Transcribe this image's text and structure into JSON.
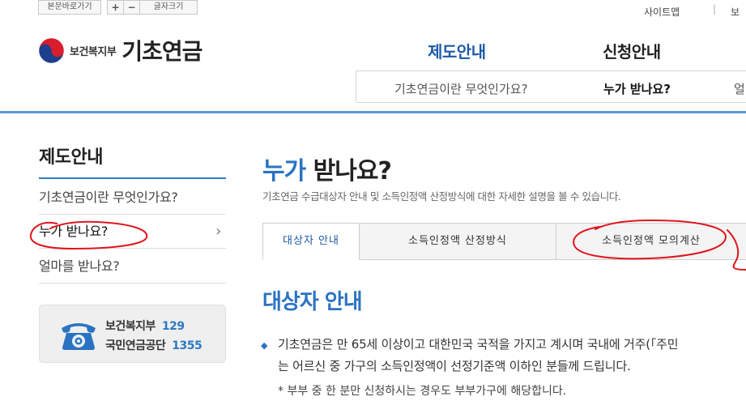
{
  "utility": {
    "skip_label": "본문바로가기",
    "font_plus": "+",
    "font_minus": "−",
    "font_size_label": "글자크기",
    "sitemap": "사이트맵",
    "separator": "|",
    "partial_right": "보"
  },
  "logo": {
    "ministry": "보건복지부",
    "name": "기초연금"
  },
  "gnb": {
    "items": [
      {
        "label": "제도안내"
      },
      {
        "label": "신청안내"
      }
    ],
    "subnav": [
      "기초연금이란 무엇인가요?",
      "누가 받나요?",
      "얼"
    ]
  },
  "lnb": {
    "title": "제도안내",
    "items": [
      {
        "label": "기초연금이란 무엇인가요?"
      },
      {
        "label": "누가 받나요?",
        "chevron": "›"
      },
      {
        "label": "얼마를 받나요?"
      }
    ]
  },
  "contact": {
    "org1": "보건복지부",
    "num1": "129",
    "org2": "국민연금공단",
    "num2": "1355"
  },
  "main": {
    "title_highlight": "누가",
    "title_rest": " 받나요?",
    "description": "기초연금 수급대상자 안내 및 소득인정액 산정방식에 대한 자세한 설명을 볼 수 있습니다.",
    "tabs": [
      {
        "label": "대상자 안내",
        "active": true
      },
      {
        "label": "소득인정액 산정방식",
        "active": false
      },
      {
        "label": "소득인정액 모의계산",
        "active": false
      }
    ],
    "section_title": "대상자 안내",
    "bullet": "◆",
    "paragraph_line1": "기초연금은 만 65세 이상이고 대한민국 국적을 가지고 계시며 국내에 거주(「주민",
    "paragraph_line2": "는 어르신 중 가구의 소득인정액이 선정기준액 이하인 분들께 드립니다.",
    "note": "* 부부 중 한 분만 신청하시는 경우도 부부가구에 해당합니다."
  },
  "colors": {
    "brand_blue": "#2a73c2",
    "annotation_red": "#e0151c",
    "top_line": "#5b9ad6"
  }
}
